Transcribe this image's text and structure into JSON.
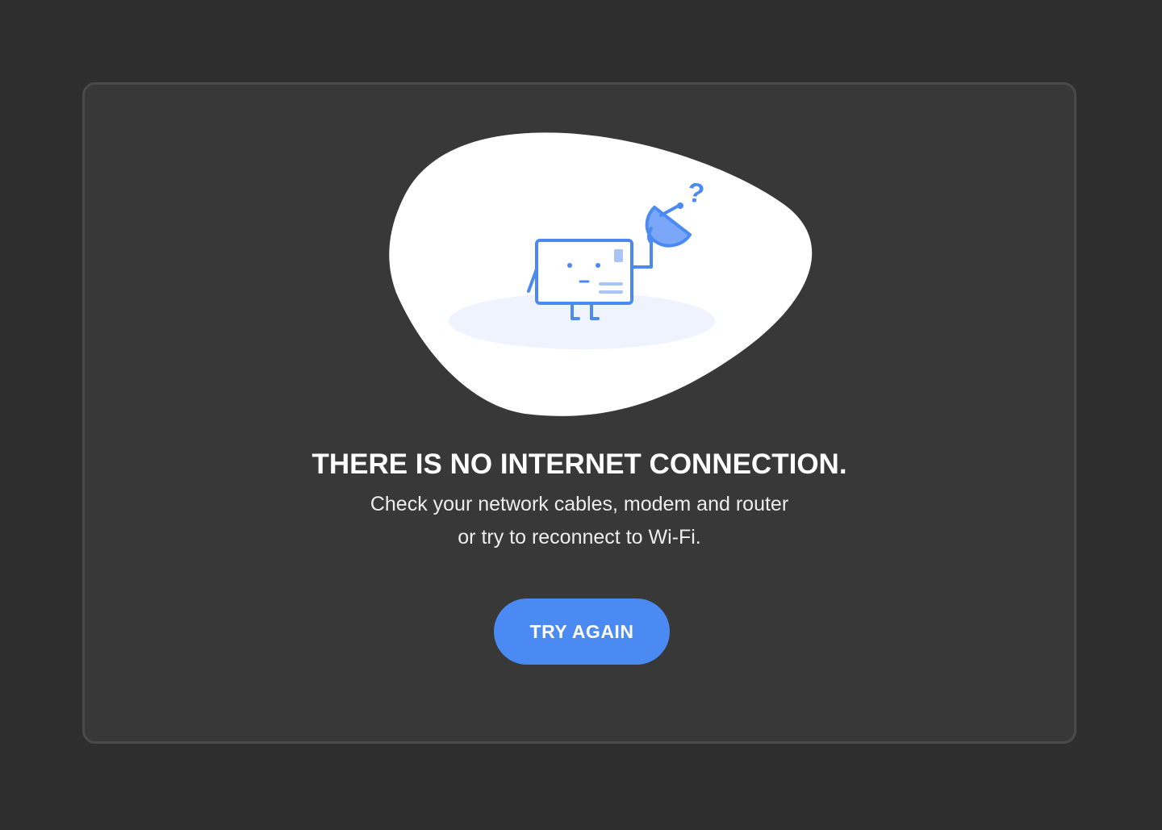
{
  "dialog": {
    "title": "THERE IS NO INTERNET CONNECTION.",
    "message_line1": "Check your network cables, modem and router",
    "message_line2": "or try to reconnect to Wi-Fi.",
    "button_label": "TRY AGAIN",
    "illustration_icon": "disconnected-card-with-satellite-dish-icon",
    "question_mark": "?"
  },
  "colors": {
    "page_background": "#2e2e2e",
    "card_background": "#383838",
    "accent": "#4b8af3",
    "blob": "#ffffff",
    "shadow": "#eef3fd"
  }
}
